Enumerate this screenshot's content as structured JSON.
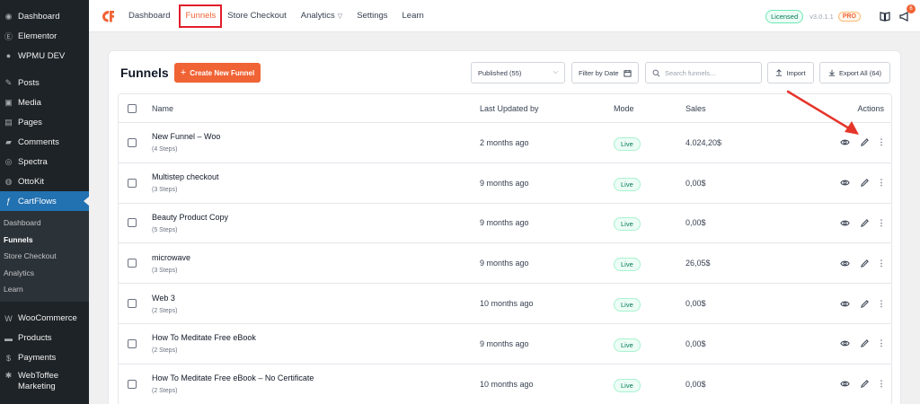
{
  "wp_menu": {
    "items_top": [
      {
        "label": "Dashboard",
        "icon": "dashboard-icon"
      },
      {
        "label": "Elementor",
        "icon": "elementor-icon"
      },
      {
        "label": "WPMU DEV",
        "icon": "wpmu-dev-icon"
      }
    ],
    "items_mid": [
      {
        "label": "Posts",
        "icon": "pin-icon"
      },
      {
        "label": "Media",
        "icon": "media-icon"
      },
      {
        "label": "Pages",
        "icon": "pages-icon"
      },
      {
        "label": "Comments",
        "icon": "comment-icon"
      },
      {
        "label": "Spectra",
        "icon": "spectra-icon"
      },
      {
        "label": "OttoKit",
        "icon": "ottokit-icon"
      },
      {
        "label": "CartFlows",
        "icon": "cartflows-icon"
      }
    ],
    "cartflows_sub": [
      "Dashboard",
      "Funnels",
      "Store Checkout",
      "Analytics",
      "Learn"
    ],
    "items_bottom": [
      {
        "label": "WooCommerce",
        "icon": "woocommerce-icon"
      },
      {
        "label": "Products",
        "icon": "products-icon"
      },
      {
        "label": "Payments",
        "icon": "payments-icon"
      },
      {
        "label": "WebToffee Marketing",
        "icon": "webtoffee-icon"
      }
    ]
  },
  "topbar": {
    "nav": [
      "Dashboard",
      "Funnels",
      "Store Checkout",
      "Analytics",
      "Settings",
      "Learn"
    ],
    "licensed": "Licensed",
    "version": "v3.0.1.1",
    "pro": "PRO",
    "notification_count": "6"
  },
  "funnels": {
    "title": "Funnels",
    "create_label": "Create New Funnel",
    "status_filter": "Published (55)",
    "date_filter": "Filter by Date",
    "search_placeholder": "Search funnels...",
    "import_label": "Import",
    "export_label": "Export All (64)",
    "columns": {
      "name": "Name",
      "updated": "Last Updated by",
      "mode": "Mode",
      "sales": "Sales",
      "actions": "Actions"
    },
    "rows": [
      {
        "name": "New Funnel – Woo",
        "steps": "(4 Steps)",
        "updated": "2 months ago",
        "mode": "Live",
        "sales": "4.024,20$"
      },
      {
        "name": "Multistep checkout",
        "steps": "(3 Steps)",
        "updated": "9 months ago",
        "mode": "Live",
        "sales": "0,00$"
      },
      {
        "name": "Beauty Product Copy",
        "steps": "(5 Steps)",
        "updated": "9 months ago",
        "mode": "Live",
        "sales": "0,00$"
      },
      {
        "name": "microwave",
        "steps": "(3 Steps)",
        "updated": "9 months ago",
        "mode": "Live",
        "sales": "26,05$"
      },
      {
        "name": "Web 3",
        "steps": "(2 Steps)",
        "updated": "10 months ago",
        "mode": "Live",
        "sales": "0,00$"
      },
      {
        "name": "How To Meditate Free eBook",
        "steps": "(2 Steps)",
        "updated": "9 months ago",
        "mode": "Live",
        "sales": "0,00$"
      },
      {
        "name": "How To Meditate Free eBook – No Certificate",
        "steps": "(2 Steps)",
        "updated": "10 months ago",
        "mode": "Live",
        "sales": "0,00$"
      }
    ]
  },
  "colors": {
    "accent": "#f06335",
    "wp_sidebar": "#1d2327",
    "wp_active": "#2271b1",
    "live_green": "#047857",
    "annotation_red": "#e5352b"
  }
}
